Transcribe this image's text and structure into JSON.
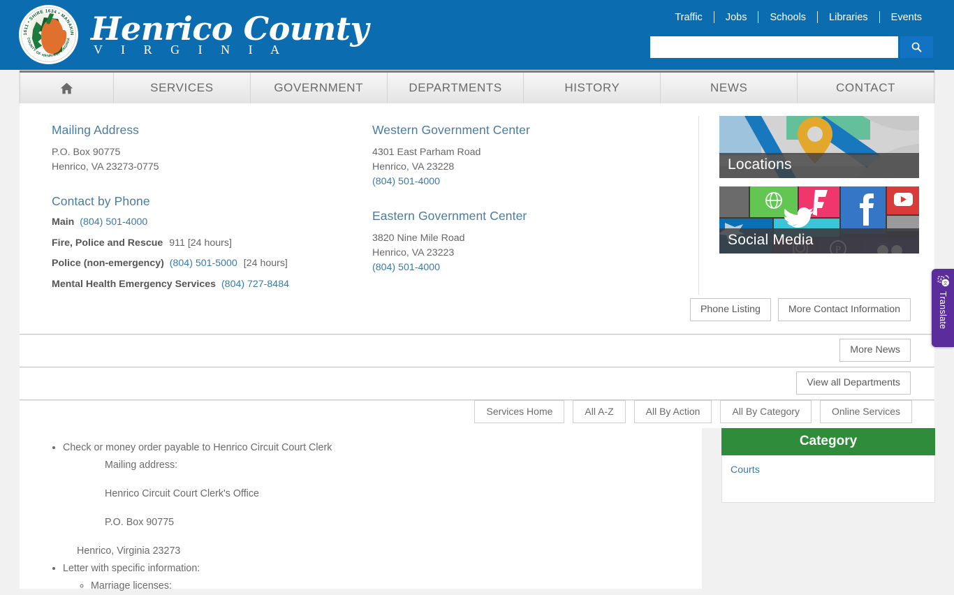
{
  "header": {
    "logo_title": "Henrico County",
    "logo_sub": "V I R G I N I A",
    "seal_text_top": "CITY 1611 • SHIRE 1634 • MANAKIN 1734",
    "seal_text_bottom": "COUNTY OF HENRICO, VIRGINIA",
    "top_links": [
      "Traffic",
      "Jobs",
      "Schools",
      "Libraries",
      "Events"
    ],
    "search": {
      "value": "",
      "placeholder": "",
      "icon": "search-icon"
    },
    "accent_blue": "#0c6cb0",
    "search_button_blue": "#1273c3"
  },
  "mainnav": {
    "home_icon": "home-icon",
    "items": [
      "SERVICES",
      "GOVERNMENT",
      "DEPARTMENTS",
      "HISTORY",
      "NEWS",
      "CONTACT"
    ]
  },
  "contact": {
    "mailing": {
      "heading": "Mailing Address",
      "lines": [
        "P.O. Box 90775",
        "Henrico, VA 23273-0775"
      ]
    },
    "phone": {
      "heading": "Contact by Phone",
      "rows": [
        {
          "label": "Main",
          "number": "(804) 501-4000",
          "note": ""
        },
        {
          "label": "Fire, Police and Rescue",
          "number": "",
          "plain": "911",
          "note": "[24 hours]"
        },
        {
          "label": "Police (non-emergency)",
          "number": "(804) 501-5000",
          "note": "[24 hours]"
        },
        {
          "label": "Mental Health Emergency Services",
          "number": "(804) 727-8484",
          "note": ""
        }
      ]
    },
    "centers": [
      {
        "heading": "Western Government Center",
        "street": "4301 East Parham Road",
        "citystate": "Henrico, VA 23228",
        "phone": "(804) 501-4000"
      },
      {
        "heading": "Eastern Government Center",
        "street": "3820 Nine Mile Road",
        "citystate": "Henrico, VA 23223",
        "phone": "(804) 501-4000"
      }
    ],
    "tiles": [
      {
        "label": "Locations",
        "name": "locations-tile"
      },
      {
        "label": "Social Media",
        "name": "social-media-tile"
      }
    ],
    "buttons": [
      "Phone Listing",
      "More Contact Information"
    ]
  },
  "news_strip": {
    "button": "More News"
  },
  "departments_strip": {
    "button": "View all Departments"
  },
  "services_tabs": [
    "Services Home",
    "All A-Z",
    "All By Action",
    "All By Category",
    "Online Services"
  ],
  "lower_content": {
    "bullet1": "Check or money order payable to Henrico Circuit Court Clerk",
    "sub1": "Mailing address:",
    "sub2": "Henrico Circuit Court Clerk's Office",
    "sub3": "P.O. Box 90775",
    "sub4": "Henrico, Virginia 23273",
    "bullet2": "Letter with specific information:",
    "bullet2a": "Marriage licenses:"
  },
  "sidebar": {
    "category_heading": "Category",
    "category_heading_color": "#2f8c3b",
    "items": [
      "Courts"
    ]
  },
  "translate_widget": {
    "label": "Translate",
    "icon": "translate-icon",
    "color": "#5b2d9c"
  }
}
